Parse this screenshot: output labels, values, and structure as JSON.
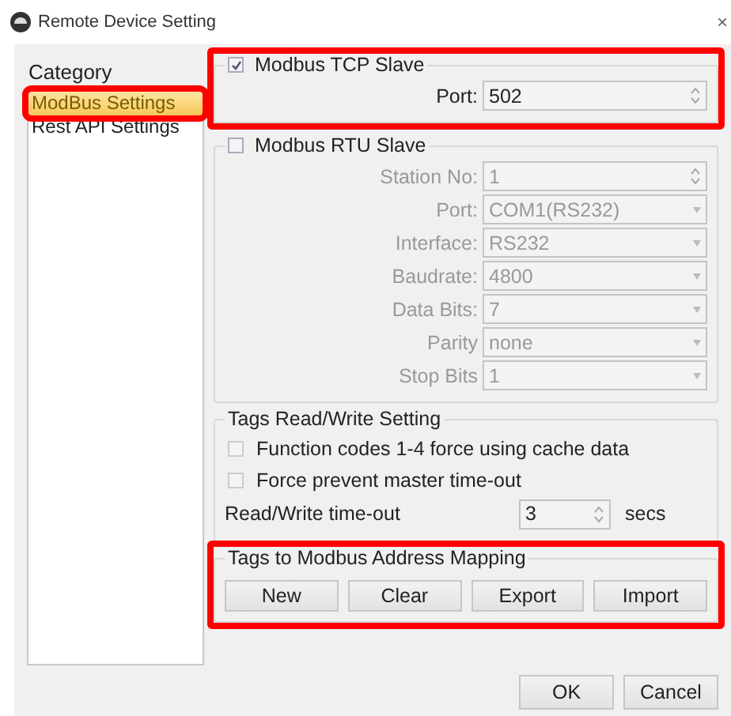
{
  "window": {
    "title": "Remote Device Setting",
    "close": "×"
  },
  "sidebar": {
    "title": "Category",
    "items": [
      {
        "label": "ModBus Settings",
        "selected": true,
        "highlighted": true
      },
      {
        "label": "Rest API Settings",
        "selected": false,
        "highlighted": false
      }
    ]
  },
  "sections": [
    {
      "title": "Modbus TCP Slave",
      "checked": true,
      "disabled": false,
      "highlighted": true,
      "fields": [
        {
          "label": "Port:",
          "value": "502",
          "kind": "spin"
        }
      ]
    },
    {
      "title": "Modbus RTU Slave",
      "checked": false,
      "disabled": true,
      "highlighted": false,
      "fields": [
        {
          "label": "Station No:",
          "value": "1",
          "kind": "spin"
        },
        {
          "label": "Port:",
          "value": "COM1(RS232)",
          "kind": "combo"
        },
        {
          "label": "Interface:",
          "value": "RS232",
          "kind": "combo"
        },
        {
          "label": "Baudrate:",
          "value": "4800",
          "kind": "combo"
        },
        {
          "label": "Data Bits:",
          "value": "7",
          "kind": "combo"
        },
        {
          "label": "Parity",
          "value": "none",
          "kind": "combo"
        },
        {
          "label": "Stop Bits",
          "value": "1",
          "kind": "combo"
        }
      ]
    },
    {
      "title": "Tags Read/Write Setting",
      "disabled": false,
      "highlighted": false,
      "options": [
        {
          "label": "Function codes 1-4 force using cache data",
          "checked": false
        },
        {
          "label": "Force prevent master time-out",
          "checked": false
        }
      ],
      "timeout": {
        "label": "Read/Write time-out",
        "value": "3",
        "unit": "secs"
      }
    },
    {
      "title": "Tags to Modbus Address Mapping",
      "disabled": false,
      "highlighted": true,
      "buttons": [
        "New",
        "Clear",
        "Export",
        "Import"
      ]
    }
  ],
  "buttons": [
    "OK",
    "Cancel"
  ]
}
